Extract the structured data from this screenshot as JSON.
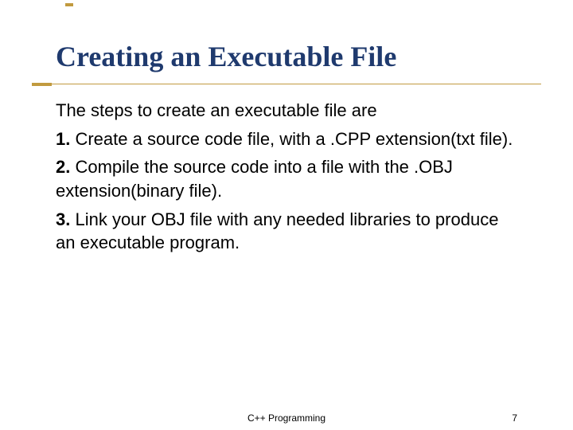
{
  "title": "Creating an Executable File",
  "intro": "The steps to create an executable file are",
  "steps": [
    {
      "num": "1.",
      "text": " Create a source code file, with a .CPP extension(txt file)."
    },
    {
      "num": "2.",
      "text": " Compile the source code into a file with the .OBJ extension(binary file)."
    },
    {
      "num": "3.",
      "text": " Link your OBJ file with any needed libraries to produce an executable program."
    }
  ],
  "footer": {
    "center": "C++ Programming",
    "pageNumber": "7"
  }
}
